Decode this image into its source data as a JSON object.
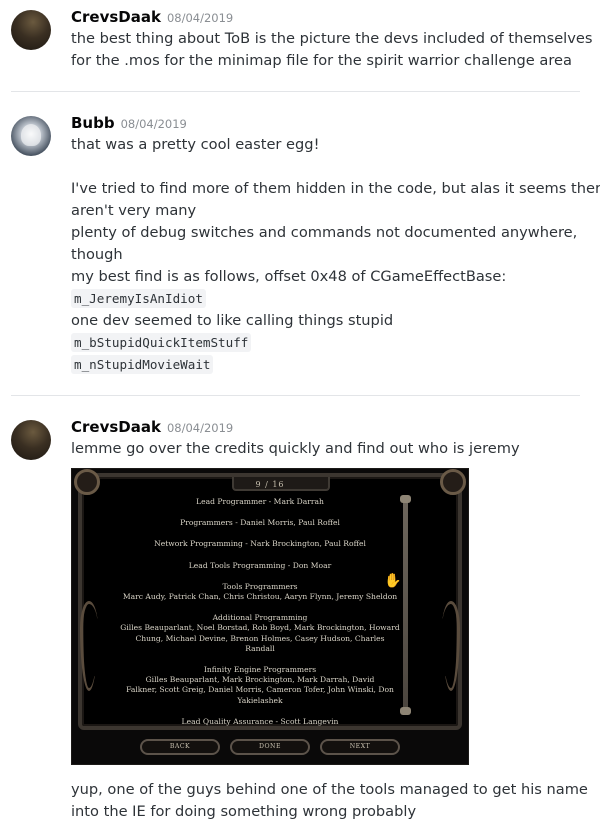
{
  "messages": [
    {
      "username": "CrevsDaak",
      "timestamp": "08/04/2019",
      "lines": [
        "the best thing about ToB is the picture the devs included of themselves",
        "for the .mos for the minimap file for the spirit warrior challenge area"
      ]
    },
    {
      "username": "Bubb",
      "timestamp": "08/04/2019",
      "lines": [
        "that was a pretty cool easter egg!",
        "",
        "I've tried to find more of them hidden in the code, but alas it seems there",
        "aren't very many",
        "plenty of debug switches and commands not documented anywhere,",
        "though",
        "my best find is as follows, offset 0x48 of CGameEffectBase:"
      ],
      "code1": "m_JeremyIsAnIdiot",
      "line_after_code1": "one dev seemed to like calling things stupid",
      "code2": "m_bStupidQuickItemStuff",
      "code3": "m_nStupidMovieWait"
    },
    {
      "username": "CrevsDaak",
      "timestamp": "08/04/2019",
      "lines": [
        "lemme go over the credits quickly and find out who is jeremy"
      ],
      "after_image_lines": [
        "yup, one of the guys behind one of the tools managed to get his name",
        "into the IE for doing something wrong probably"
      ]
    }
  ],
  "attachment": {
    "page_indicator": "9 / 16",
    "credits": [
      "Lead Programmer - Mark Darrah",
      "Programmers - Daniel Morris, Paul Roffel",
      "Network Programming - Nark Brockington, Paul Roffel",
      "Lead Tools Programming - Don Moar",
      "Tools Programmers",
      "Marc Audy, Patrick Chan, Chris Christou, Aaryn Flynn, Jeremy Sheldon",
      "Additional Programming",
      "Gilles Beauparlant, Noel Borstad, Rob Boyd, Mark Brockington, Howard",
      "Chung, Michael Devine, Brenon Holmes, Casey Hudson, Charles",
      "Randall",
      "Infinity Engine Programmers",
      "Gilles Beauparlant, Mark Brockington, Mark Darrah, David",
      "Falkner, Scott Greig, Daniel Morris, Cameron Tofer, John Winski, Don",
      "Yakielashek",
      "Lead Quality Assurance - Scott Langevin"
    ],
    "buttons": [
      "BACK",
      "DONE",
      "NEXT"
    ]
  }
}
